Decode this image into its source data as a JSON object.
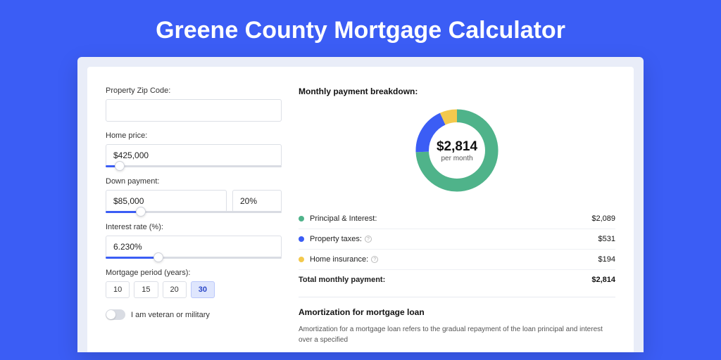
{
  "page_title": "Greene County Mortgage Calculator",
  "form": {
    "zip_label": "Property Zip Code:",
    "zip_value": "",
    "price_label": "Home price:",
    "price_value": "$425,000",
    "price_slider_pct": 8,
    "down_label": "Down payment:",
    "down_value": "$85,000",
    "down_pct": "20%",
    "down_slider_pct": 20,
    "rate_label": "Interest rate (%):",
    "rate_value": "6.230%",
    "rate_slider_pct": 30,
    "period_label": "Mortgage period (years):",
    "periods": [
      "10",
      "15",
      "20",
      "30"
    ],
    "period_active": "30",
    "veteran_label": "I am veteran or military",
    "veteran_on": false
  },
  "breakdown": {
    "title": "Monthly payment breakdown:",
    "center_amount": "$2,814",
    "center_sub": "per month",
    "rows": [
      {
        "label": "Principal & Interest:",
        "value": "$2,089",
        "color": "#4fb38a",
        "info": false
      },
      {
        "label": "Property taxes:",
        "value": "$531",
        "color": "#3b5df5",
        "info": true
      },
      {
        "label": "Home insurance:",
        "value": "$194",
        "color": "#f3c94d",
        "info": true
      }
    ],
    "total_label": "Total monthly payment:",
    "total_value": "$2,814"
  },
  "chart_data": {
    "type": "pie",
    "title": "Monthly payment breakdown",
    "series": [
      {
        "name": "Principal & Interest",
        "value": 2089,
        "color": "#4fb38a"
      },
      {
        "name": "Property taxes",
        "value": 531,
        "color": "#3b5df5"
      },
      {
        "name": "Home insurance",
        "value": 194,
        "color": "#f3c94d"
      }
    ],
    "total": 2814
  },
  "amort": {
    "title": "Amortization for mortgage loan",
    "text": "Amortization for a mortgage loan refers to the gradual repayment of the loan principal and interest over a specified"
  }
}
